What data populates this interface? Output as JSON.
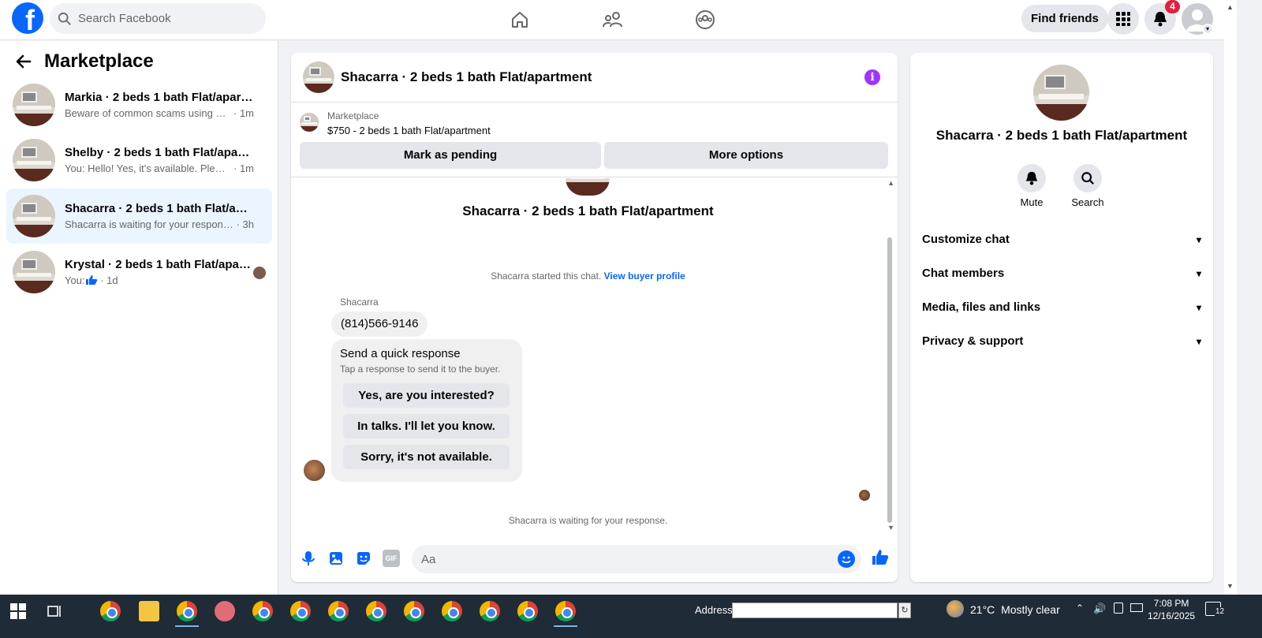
{
  "topbar": {
    "logo": "f",
    "search_placeholder": "Search Facebook",
    "find_friends": "Find friends",
    "notification_count": "4"
  },
  "sidebar": {
    "title": "Marketplace",
    "conversations": [
      {
        "name": "Markia · 2 beds 1 bath Flat/apartm...",
        "snippet": "Beware of common scams using pay...",
        "time": "· 1m"
      },
      {
        "name": "Shelby · 2 beds 1 bath Flat/apartm...",
        "snippet": "You: Hello! Yes, it's available. Please s...",
        "time": "· 1m"
      },
      {
        "name": "Shacarra · 2 beds 1 bath Flat/apart...",
        "snippet": "Shacarra is waiting for your response.",
        "time": "· 3h"
      },
      {
        "name": "Krystal · 2 beds 1 bath Flat/apart...",
        "snippet": "You: ",
        "time": "· 1d"
      }
    ]
  },
  "chat": {
    "title": "Shacarra · 2 beds 1 bath Flat/apartment",
    "listing_kind": "Marketplace",
    "listing_price": "$750 - 2 beds 1 bath Flat/apartment",
    "mark_pending": "Mark as pending",
    "more_options": "More options",
    "thread_title": "Shacarra · 2 beds 1 bath Flat/apartment",
    "started_text": "Shacarra started this chat.",
    "view_buyer": "View buyer profile",
    "sender_name": "Shacarra",
    "phone": "(814)566-9146",
    "quick_title": "Send a quick response",
    "quick_subtitle": "Tap a response to send it to the buyer.",
    "quick_options": [
      "Yes, are you interested?",
      "In talks. I'll let you know.",
      "Sorry, it's not available."
    ],
    "waiting": "Shacarra is waiting for your response.",
    "composer_placeholder": "Aa",
    "gif_label": "GIF"
  },
  "details": {
    "title": "Shacarra · 2 beds 1 bath Flat/apartment",
    "mute": "Mute",
    "search": "Search",
    "sections": [
      "Customize chat",
      "Chat members",
      "Media, files and links",
      "Privacy & support"
    ]
  },
  "taskbar": {
    "address_label": "Address",
    "temperature": "21°C",
    "weather": "Mostly clear",
    "time": "7:08 PM",
    "date": "12/16/2025",
    "notif_count": "12"
  },
  "colors": {
    "brand": "#0866ff",
    "info": "#a033ff",
    "badge": "#e41e3f",
    "active_row": "#ebf5ff"
  }
}
